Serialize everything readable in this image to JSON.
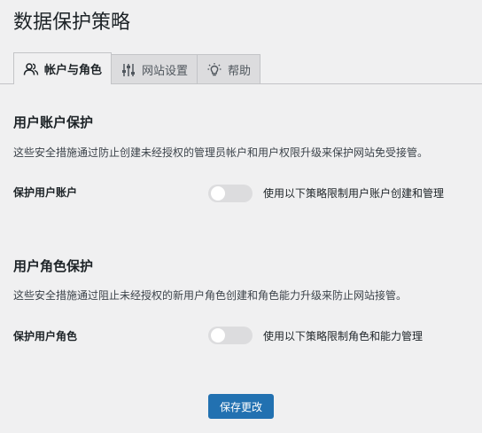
{
  "page": {
    "title": "数据保护策略"
  },
  "tabs": [
    {
      "label": "帐户与角色",
      "icon": "users-icon",
      "active": true
    },
    {
      "label": "网站设置",
      "icon": "sliders-icon",
      "active": false
    },
    {
      "label": "帮助",
      "icon": "lightbulb-icon",
      "active": false
    }
  ],
  "sections": [
    {
      "title": "用户账户保护",
      "description": "这些安全措施通过防止创建未经授权的管理员帐户和用户权限升级来保护网站免受接管。",
      "field_label": "保护用户账户",
      "toggle_text": "使用以下策略限制用户账户创建和管理",
      "enabled": false
    },
    {
      "title": "用户角色保护",
      "description": "这些安全措施通过阻止未经授权的新用户角色创建和角色能力升级来防止网站接管。",
      "field_label": "保护用户角色",
      "toggle_text": "使用以下策略限制角色和能力管理",
      "enabled": false
    }
  ],
  "actions": {
    "save_label": "保存更改"
  },
  "colors": {
    "primary": "#2271b1",
    "background": "#f0f0f1",
    "toggle_off": "#dcdcde"
  }
}
